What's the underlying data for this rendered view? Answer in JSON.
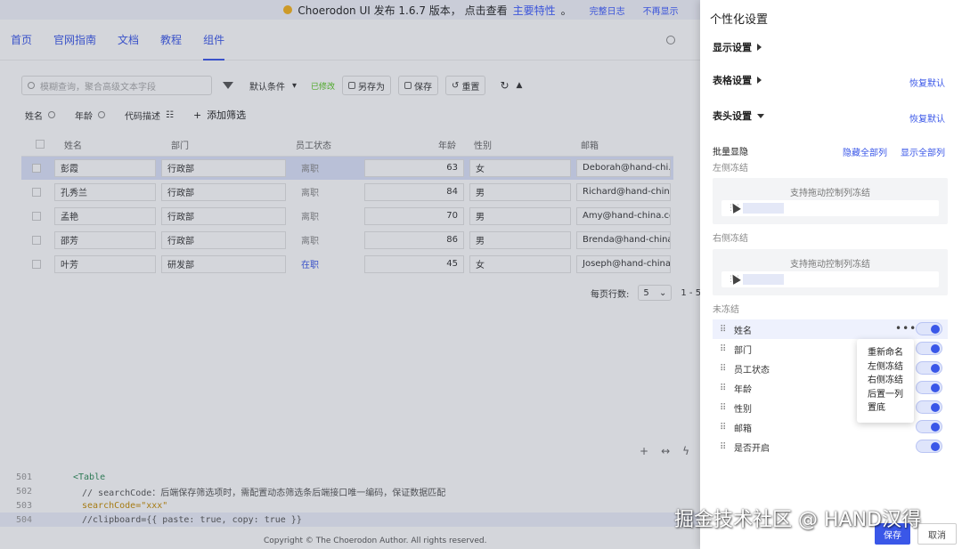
{
  "notice": {
    "text": "Choerodon UI 发布 1.6.7 版本， 点击查看",
    "link": "主要特性",
    "suffix": "。",
    "changelog": "完整日志",
    "dismiss": "不再显示"
  },
  "nav": {
    "items": [
      "首页",
      "官网指南",
      "文档",
      "教程",
      "组件"
    ],
    "active_index": 4
  },
  "toolbar": {
    "search_placeholder": "模糊查询，聚合高级文本字段",
    "condition": "默认条件",
    "modified": "已修改",
    "save_as": "另存为",
    "save": "保存",
    "reset": "重置"
  },
  "filters": {
    "items": [
      "姓名",
      "年龄",
      "代码描述"
    ],
    "add": "添加筛选"
  },
  "table": {
    "headers": [
      "姓名",
      "部门",
      "员工状态",
      "年龄",
      "性别",
      "邮箱"
    ],
    "rows": [
      {
        "name": "彭霞",
        "dept": "行政部",
        "status": "离职",
        "age": "63",
        "gender": "女",
        "email": "Deborah@hand-chi...",
        "selected": true,
        "on": false
      },
      {
        "name": "孔秀兰",
        "dept": "行政部",
        "status": "离职",
        "age": "84",
        "gender": "男",
        "email": "Richard@hand-chin...",
        "selected": false,
        "on": false
      },
      {
        "name": "孟艳",
        "dept": "行政部",
        "status": "离职",
        "age": "70",
        "gender": "男",
        "email": "Amy@hand-china.co...",
        "selected": false,
        "on": false
      },
      {
        "name": "邵芳",
        "dept": "行政部",
        "status": "离职",
        "age": "86",
        "gender": "男",
        "email": "Brenda@hand-china...",
        "selected": false,
        "on": false
      },
      {
        "name": "叶芳",
        "dept": "研发部",
        "status": "在职",
        "age": "45",
        "gender": "女",
        "email": "Joseph@hand-china...",
        "selected": false,
        "on": true
      }
    ]
  },
  "pager": {
    "label": "每页行数:",
    "size": "5",
    "range": "1 - 5"
  },
  "code": {
    "lines": [
      {
        "num": "501",
        "text": "<Table"
      },
      {
        "num": "502",
        "text": "// searchCode：后端保存筛选项时，需配置动态筛选条后端接口唯一编码，保证数据匹配"
      },
      {
        "num": "503",
        "text": "searchCode=\"xxx\""
      },
      {
        "num": "504",
        "text": "//clipboard={{ paste: true, copy: true }}"
      }
    ]
  },
  "footer": "Copyright © The Choerodon Author. All rights reserved.",
  "drawer": {
    "title": "个性化设置",
    "display": "显示设置",
    "table": "表格设置",
    "header": "表头设置",
    "reset": "恢复默认",
    "bulk": "批量显隐",
    "hide_all": "隐藏全部列",
    "show_all": "显示全部列",
    "left_frozen": "左侧冻结",
    "right_frozen": "右侧冻结",
    "unfrozen": "未冻结",
    "drag_hint": "支持拖动控制列冻结",
    "columns": [
      "姓名",
      "部门",
      "员工状态",
      "年龄",
      "性别",
      "邮箱",
      "是否开启"
    ],
    "menu": [
      "重新命名",
      "左侧冻结",
      "右侧冻结",
      "后置一列",
      "置底"
    ],
    "save": "保存",
    "cancel": "取消"
  },
  "watermark": "掘金技术社区 @ HAND汉得",
  "colors": {
    "primary": "#3a57e8",
    "modified": "#52c41a",
    "notice_dot": "#f6b21a"
  }
}
